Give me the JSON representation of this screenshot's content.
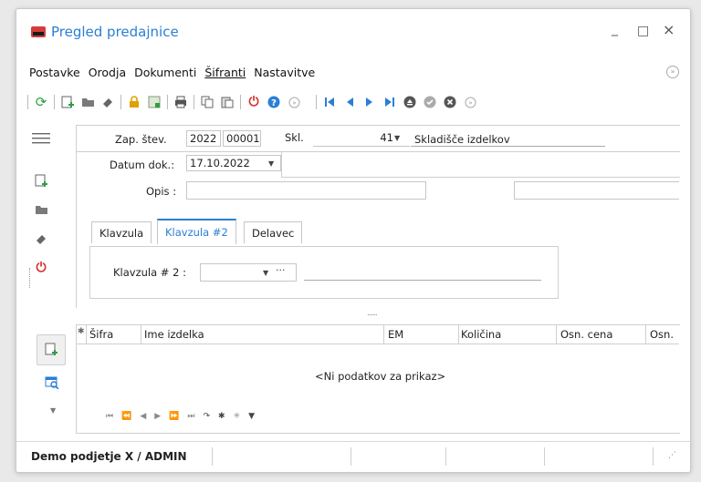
{
  "window": {
    "title": "Pregled predajnice",
    "minimize": "_",
    "maximize": "□",
    "close": "×"
  },
  "menu": [
    "Postavke",
    "Orodja",
    "Dokumenti",
    "Šifranti",
    "Nastavitve"
  ],
  "header": {
    "zap_label": "Zap. štev.",
    "zap_year": "2022",
    "zap_num": "00001",
    "skl_label": "Skl.",
    "skl_value": "41",
    "skl_name": "Skladišče izdelkov"
  },
  "form": {
    "datum_label": "Datum dok.:",
    "datum_value": "17.10.2022",
    "opis_label": "Opis :",
    "opis_value": ""
  },
  "tabs": [
    "Klavzula",
    "Klavzula #2",
    "Delavec"
  ],
  "tab_content": {
    "label": "Klavzula # 2 :",
    "ellipsis": "···"
  },
  "splitter": ".......",
  "grid": {
    "columns": [
      "Šifra",
      "Ime izdelka",
      "EM",
      "Količina",
      "Osn. cena",
      "Osn."
    ],
    "empty_text": "<Ni podatkov za prikaz>",
    "star": "✱"
  },
  "status": {
    "company": "Demo podjetje X / ADMIN"
  },
  "colors": {
    "accent": "#2a7fd4",
    "red": "#d9302c",
    "green": "#2e9e44",
    "gold": "#e0a100"
  }
}
